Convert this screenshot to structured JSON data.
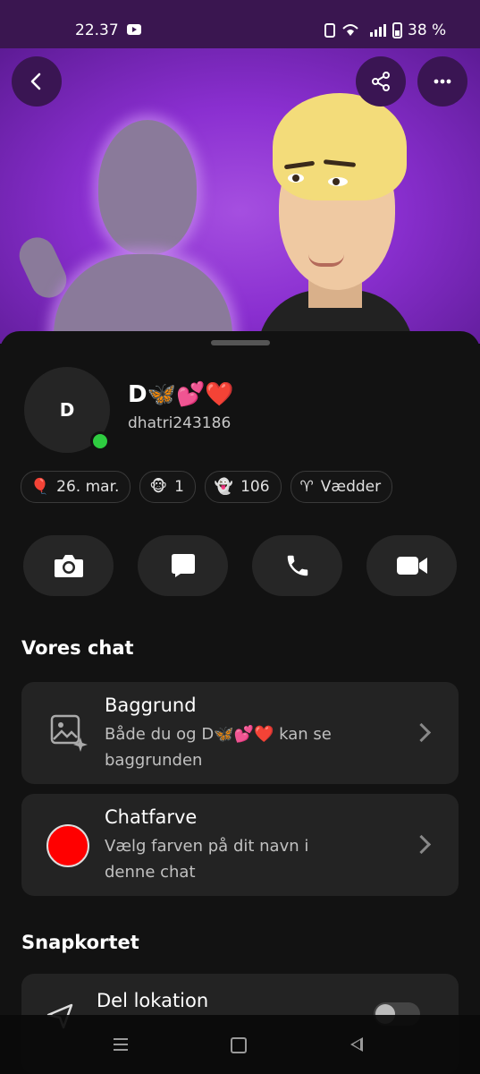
{
  "status_bar": {
    "time": "22.37",
    "battery": "38 %"
  },
  "profile": {
    "avatar_initial": "D",
    "display_name": "D🦋💕❤️",
    "username": "dhatri243186"
  },
  "chips": [
    {
      "icon": "🎈",
      "label": "26. mar."
    },
    {
      "icon": "🐵",
      "label": "1"
    },
    {
      "icon": "👻",
      "label": "106"
    },
    {
      "icon": "♈",
      "label": "Vædder"
    }
  ],
  "sections": {
    "our_chat": "Vores chat",
    "snap_map": "Snapkortet"
  },
  "background_card": {
    "title": "Baggrund",
    "subtitle_line1": "Både du og D🦋💕❤️ kan se",
    "subtitle_line2": "baggrunden"
  },
  "chat_color_card": {
    "title": "Chatfarve",
    "subtitle_line1": "Vælg farven på dit navn i",
    "subtitle_line2": "denne chat",
    "color": "#ff0000"
  },
  "location_card": {
    "title": "Del lokation",
    "toggle_on": false
  },
  "colors": {
    "accent_purple": "#8a2fd0",
    "online": "#2ecc40"
  }
}
